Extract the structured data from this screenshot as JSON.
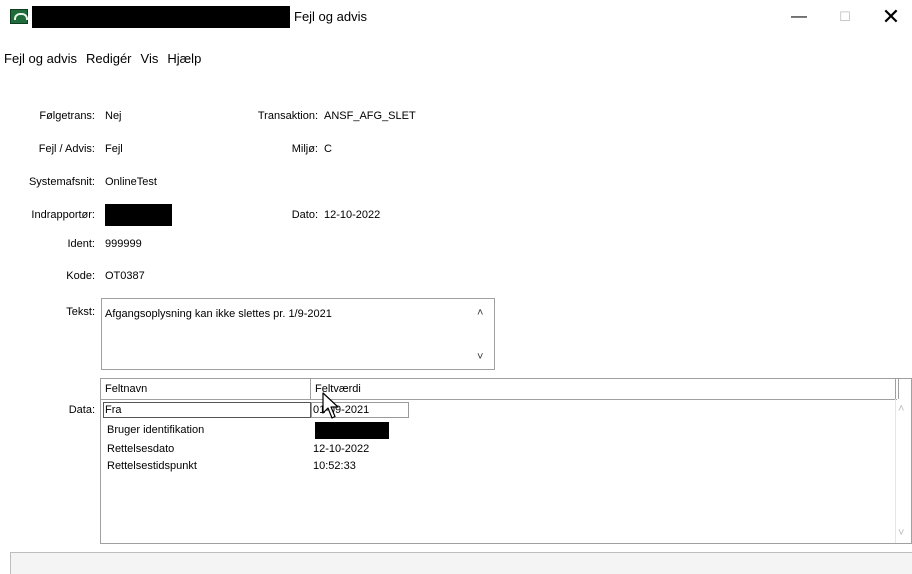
{
  "window": {
    "title": "Fejl og advis",
    "controls": {
      "minimize": "—",
      "maximize": "☐",
      "close": "✕"
    }
  },
  "menu": [
    "Fejl og advis",
    "Redigér",
    "Vis",
    "Hjælp"
  ],
  "fields": {
    "folgetrans": {
      "label": "Følgetrans:",
      "value": "Nej"
    },
    "fejl_advis": {
      "label": "Fejl / Advis:",
      "value": "Fejl"
    },
    "systemafsnit": {
      "label": "Systemafsnit:",
      "value": "OnlineTest"
    },
    "indrapportor": {
      "label": "Indrapportør:",
      "value": ""
    },
    "ident": {
      "label": "Ident:",
      "value": "999999"
    },
    "kode": {
      "label": "Kode:",
      "value": "OT0387"
    },
    "transaktion": {
      "label": "Transaktion:",
      "value": "ANSF_AFG_SLET"
    },
    "miljo": {
      "label": "Miljø:",
      "value": "C"
    },
    "dato": {
      "label": "Dato:",
      "value": "12-10-2022"
    },
    "tekst": {
      "label": "Tekst:",
      "value": "Afgangsoplysning kan ikke slettes pr. 1/9-2021"
    },
    "data": {
      "label": "Data:"
    }
  },
  "grid": {
    "columns": [
      "Feltnavn",
      "Feltværdi"
    ],
    "rows": [
      {
        "name": "Fra",
        "value": "01-09-2021"
      },
      {
        "name": "Bruger identifikation",
        "value": ""
      },
      {
        "name": "Rettelsesdato",
        "value": "12-10-2022"
      },
      {
        "name": "Rettelsestidspunkt",
        "value": "10:52:33"
      }
    ]
  },
  "statusbar": {
    "text": ""
  }
}
